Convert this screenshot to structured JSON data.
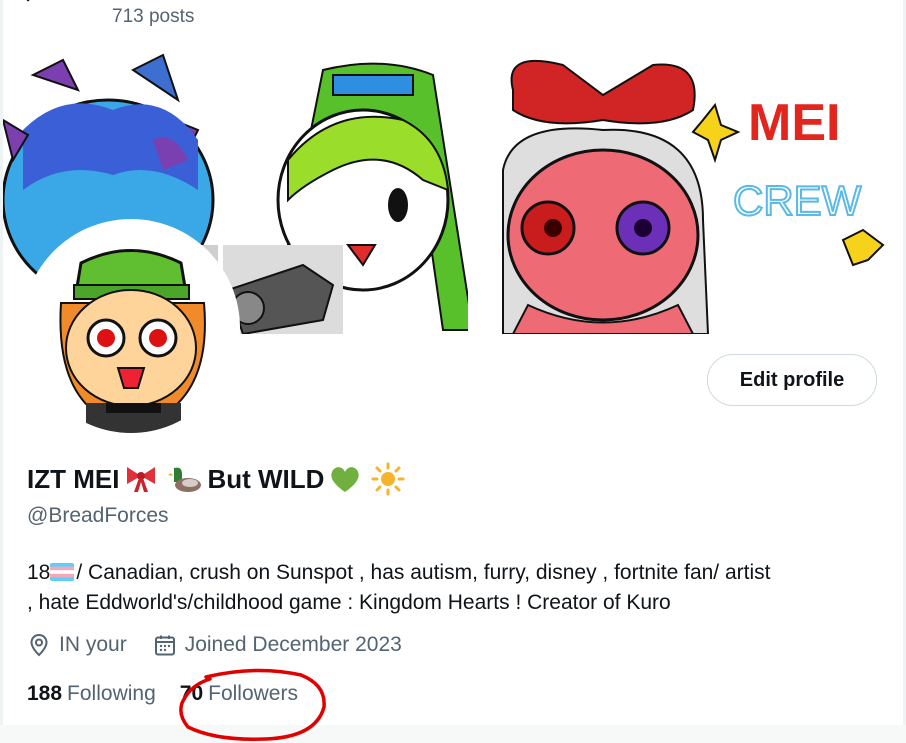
{
  "header": {
    "posts_count": "713 posts"
  },
  "banner": {
    "text_mei": "MEI",
    "text_crew": "CREW"
  },
  "profile": {
    "edit_button_label": "Edit profile",
    "display_name_part1": "IZT MEI",
    "display_name_part2": "But WILD",
    "handle": "@BreadForces",
    "bio_age": "18",
    "bio_line1_rest": "/ Canadian, crush on Sunspot , has autism, furry,  disney , fortnite  fan/ artist",
    "bio_line2": ", hate  Eddworld's/childhood game : Kingdom Hearts ! Creator of Kuro",
    "location": "IN your",
    "joined": "Joined December 2023"
  },
  "stats": {
    "following_count": "188",
    "following_label": "Following",
    "followers_count": "70",
    "followers_label": "Followers"
  },
  "colors": {
    "annotation_circle": "#e00000",
    "secondary_text": "#536471",
    "primary_text": "#0f1419",
    "border": "#cfd9de"
  },
  "icons": {
    "location": "map-pin-icon",
    "joined": "calendar-icon",
    "back": "back-arrow-icon"
  }
}
